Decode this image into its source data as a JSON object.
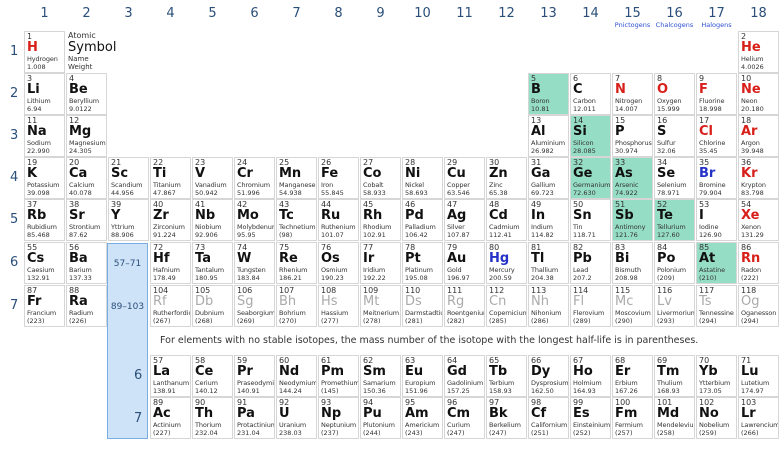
{
  "groups": [
    "1",
    "2",
    "3",
    "4",
    "5",
    "6",
    "7",
    "8",
    "9",
    "10",
    "11",
    "12",
    "13",
    "14",
    "15",
    "16",
    "17",
    "18"
  ],
  "group_subtitles": {
    "15": "Pnictogens",
    "16": "Chalcogens",
    "17": "Halogens"
  },
  "periods": [
    "1",
    "2",
    "3",
    "4",
    "5",
    "6",
    "7"
  ],
  "legend": {
    "z": "Atomic",
    "symbol": "Symbol",
    "name": "Name",
    "weight": "Weight"
  },
  "f_ranges": [
    "57–71",
    "89–103"
  ],
  "f_periods": [
    "6",
    "7"
  ],
  "note": "For elements with no stable isotopes, the mass number of the isotope with the longest half-life is in parentheses.",
  "elements": [
    {
      "z": "1",
      "s": "H",
      "n": "Hydrogen",
      "w": "1.008",
      "g": 1,
      "p": 1,
      "st": "gas"
    },
    {
      "z": "2",
      "s": "He",
      "n": "Helium",
      "w": "4.0026",
      "g": 18,
      "p": 1,
      "st": "gas"
    },
    {
      "z": "3",
      "s": "Li",
      "n": "Lithium",
      "w": "6.94",
      "g": 1,
      "p": 2
    },
    {
      "z": "4",
      "s": "Be",
      "n": "Beryllium",
      "w": "9.0122",
      "g": 2,
      "p": 2
    },
    {
      "z": "5",
      "s": "B",
      "n": "Boron",
      "w": "10.81",
      "g": 13,
      "p": 2,
      "m": 1
    },
    {
      "z": "6",
      "s": "C",
      "n": "Carbon",
      "w": "12.011",
      "g": 14,
      "p": 2
    },
    {
      "z": "7",
      "s": "N",
      "n": "Nitrogen",
      "w": "14.007",
      "g": 15,
      "p": 2,
      "st": "gas"
    },
    {
      "z": "8",
      "s": "O",
      "n": "Oxygen",
      "w": "15.999",
      "g": 16,
      "p": 2,
      "st": "gas"
    },
    {
      "z": "9",
      "s": "F",
      "n": "Fluorine",
      "w": "18.998",
      "g": 17,
      "p": 2,
      "st": "gas"
    },
    {
      "z": "10",
      "s": "Ne",
      "n": "Neon",
      "w": "20.180",
      "g": 18,
      "p": 2,
      "st": "gas"
    },
    {
      "z": "11",
      "s": "Na",
      "n": "Sodium",
      "w": "22.990",
      "g": 1,
      "p": 3
    },
    {
      "z": "12",
      "s": "Mg",
      "n": "Magnesium",
      "w": "24.305",
      "g": 2,
      "p": 3
    },
    {
      "z": "13",
      "s": "Al",
      "n": "Aluminium",
      "w": "26.982",
      "g": 13,
      "p": 3
    },
    {
      "z": "14",
      "s": "Si",
      "n": "Silicon",
      "w": "28.085",
      "g": 14,
      "p": 3,
      "m": 1
    },
    {
      "z": "15",
      "s": "P",
      "n": "Phosphorus",
      "w": "30.974",
      "g": 15,
      "p": 3
    },
    {
      "z": "16",
      "s": "S",
      "n": "Sulfur",
      "w": "32.06",
      "g": 16,
      "p": 3
    },
    {
      "z": "17",
      "s": "Cl",
      "n": "Chlorine",
      "w": "35.45",
      "g": 17,
      "p": 3,
      "st": "gas"
    },
    {
      "z": "18",
      "s": "Ar",
      "n": "Argon",
      "w": "39.948",
      "g": 18,
      "p": 3,
      "st": "gas"
    },
    {
      "z": "19",
      "s": "K",
      "n": "Potassium",
      "w": "39.098",
      "g": 1,
      "p": 4
    },
    {
      "z": "20",
      "s": "Ca",
      "n": "Calcium",
      "w": "40.078",
      "g": 2,
      "p": 4
    },
    {
      "z": "21",
      "s": "Sc",
      "n": "Scandium",
      "w": "44.956",
      "g": 3,
      "p": 4
    },
    {
      "z": "22",
      "s": "Ti",
      "n": "Titanium",
      "w": "47.867",
      "g": 4,
      "p": 4
    },
    {
      "z": "23",
      "s": "V",
      "n": "Vanadium",
      "w": "50.942",
      "g": 5,
      "p": 4
    },
    {
      "z": "24",
      "s": "Cr",
      "n": "Chromium",
      "w": "51.996",
      "g": 6,
      "p": 4
    },
    {
      "z": "25",
      "s": "Mn",
      "n": "Manganese",
      "w": "54.938",
      "g": 7,
      "p": 4
    },
    {
      "z": "26",
      "s": "Fe",
      "n": "Iron",
      "w": "55.845",
      "g": 8,
      "p": 4
    },
    {
      "z": "27",
      "s": "Co",
      "n": "Cobalt",
      "w": "58.933",
      "g": 9,
      "p": 4
    },
    {
      "z": "28",
      "s": "Ni",
      "n": "Nickel",
      "w": "58.693",
      "g": 10,
      "p": 4
    },
    {
      "z": "29",
      "s": "Cu",
      "n": "Copper",
      "w": "63.546",
      "g": 11,
      "p": 4
    },
    {
      "z": "30",
      "s": "Zn",
      "n": "Zinc",
      "w": "65.38",
      "g": 12,
      "p": 4
    },
    {
      "z": "31",
      "s": "Ga",
      "n": "Gallium",
      "w": "69.723",
      "g": 13,
      "p": 4
    },
    {
      "z": "32",
      "s": "Ge",
      "n": "Germanium",
      "w": "72.630",
      "g": 14,
      "p": 4,
      "m": 1
    },
    {
      "z": "33",
      "s": "As",
      "n": "Arsenic",
      "w": "74.922",
      "g": 15,
      "p": 4,
      "m": 1
    },
    {
      "z": "34",
      "s": "Se",
      "n": "Selenium",
      "w": "78.971",
      "g": 16,
      "p": 4
    },
    {
      "z": "35",
      "s": "Br",
      "n": "Bromine",
      "w": "79.904",
      "g": 17,
      "p": 4,
      "st": "liq"
    },
    {
      "z": "36",
      "s": "Kr",
      "n": "Krypton",
      "w": "83.798",
      "g": 18,
      "p": 4,
      "st": "gas"
    },
    {
      "z": "37",
      "s": "Rb",
      "n": "Rubidium",
      "w": "85.468",
      "g": 1,
      "p": 5
    },
    {
      "z": "38",
      "s": "Sr",
      "n": "Strontium",
      "w": "87.62",
      "g": 2,
      "p": 5
    },
    {
      "z": "39",
      "s": "Y",
      "n": "Yttrium",
      "w": "88.906",
      "g": 3,
      "p": 5
    },
    {
      "z": "40",
      "s": "Zr",
      "n": "Zirconium",
      "w": "91.224",
      "g": 4,
      "p": 5
    },
    {
      "z": "41",
      "s": "Nb",
      "n": "Niobium",
      "w": "92.906",
      "g": 5,
      "p": 5
    },
    {
      "z": "42",
      "s": "Mo",
      "n": "Molybdenum",
      "w": "95.95",
      "g": 6,
      "p": 5
    },
    {
      "z": "43",
      "s": "Tc",
      "n": "Technetium",
      "w": "(98)",
      "g": 7,
      "p": 5
    },
    {
      "z": "44",
      "s": "Ru",
      "n": "Ruthenium",
      "w": "101.07",
      "g": 8,
      "p": 5
    },
    {
      "z": "45",
      "s": "Rh",
      "n": "Rhodium",
      "w": "102.91",
      "g": 9,
      "p": 5
    },
    {
      "z": "46",
      "s": "Pd",
      "n": "Palladium",
      "w": "106.42",
      "g": 10,
      "p": 5
    },
    {
      "z": "47",
      "s": "Ag",
      "n": "Silver",
      "w": "107.87",
      "g": 11,
      "p": 5
    },
    {
      "z": "48",
      "s": "Cd",
      "n": "Cadmium",
      "w": "112.41",
      "g": 12,
      "p": 5
    },
    {
      "z": "49",
      "s": "In",
      "n": "Indium",
      "w": "114.82",
      "g": 13,
      "p": 5
    },
    {
      "z": "50",
      "s": "Sn",
      "n": "Tin",
      "w": "118.71",
      "g": 14,
      "p": 5
    },
    {
      "z": "51",
      "s": "Sb",
      "n": "Antimony",
      "w": "121.76",
      "g": 15,
      "p": 5,
      "m": 1
    },
    {
      "z": "52",
      "s": "Te",
      "n": "Tellurium",
      "w": "127.60",
      "g": 16,
      "p": 5,
      "m": 1
    },
    {
      "z": "53",
      "s": "I",
      "n": "Iodine",
      "w": "126.90",
      "g": 17,
      "p": 5
    },
    {
      "z": "54",
      "s": "Xe",
      "n": "Xenon",
      "w": "131.29",
      "g": 18,
      "p": 5,
      "st": "gas"
    },
    {
      "z": "55",
      "s": "Cs",
      "n": "Caesium",
      "w": "132.91",
      "g": 1,
      "p": 6
    },
    {
      "z": "56",
      "s": "Ba",
      "n": "Barium",
      "w": "137.33",
      "g": 2,
      "p": 6
    },
    {
      "z": "72",
      "s": "Hf",
      "n": "Hafnium",
      "w": "178.49",
      "g": 4,
      "p": 6
    },
    {
      "z": "73",
      "s": "Ta",
      "n": "Tantalum",
      "w": "180.95",
      "g": 5,
      "p": 6
    },
    {
      "z": "74",
      "s": "W",
      "n": "Tungsten",
      "w": "183.84",
      "g": 6,
      "p": 6
    },
    {
      "z": "75",
      "s": "Re",
      "n": "Rhenium",
      "w": "186.21",
      "g": 7,
      "p": 6
    },
    {
      "z": "76",
      "s": "Os",
      "n": "Osmium",
      "w": "190.23",
      "g": 8,
      "p": 6
    },
    {
      "z": "77",
      "s": "Ir",
      "n": "Iridium",
      "w": "192.22",
      "g": 9,
      "p": 6
    },
    {
      "z": "78",
      "s": "Pt",
      "n": "Platinum",
      "w": "195.08",
      "g": 10,
      "p": 6
    },
    {
      "z": "79",
      "s": "Au",
      "n": "Gold",
      "w": "196.97",
      "g": 11,
      "p": 6
    },
    {
      "z": "80",
      "s": "Hg",
      "n": "Mercury",
      "w": "200.59",
      "g": 12,
      "p": 6,
      "st": "liq"
    },
    {
      "z": "81",
      "s": "Tl",
      "n": "Thallium",
      "w": "204.38",
      "g": 13,
      "p": 6
    },
    {
      "z": "82",
      "s": "Pb",
      "n": "Lead",
      "w": "207.2",
      "g": 14,
      "p": 6
    },
    {
      "z": "83",
      "s": "Bi",
      "n": "Bismuth",
      "w": "208.98",
      "g": 15,
      "p": 6
    },
    {
      "z": "84",
      "s": "Po",
      "n": "Polonium",
      "w": "(209)",
      "g": 16,
      "p": 6
    },
    {
      "z": "85",
      "s": "At",
      "n": "Astatine",
      "w": "(210)",
      "g": 17,
      "p": 6,
      "m": 1
    },
    {
      "z": "86",
      "s": "Rn",
      "n": "Radon",
      "w": "(222)",
      "g": 18,
      "p": 6,
      "st": "gas"
    },
    {
      "z": "87",
      "s": "Fr",
      "n": "Francium",
      "w": "(223)",
      "g": 1,
      "p": 7
    },
    {
      "z": "88",
      "s": "Ra",
      "n": "Radium",
      "w": "(226)",
      "g": 2,
      "p": 7
    },
    {
      "z": "104",
      "s": "Rf",
      "n": "Rutherfordium",
      "w": "(267)",
      "g": 4,
      "p": 7,
      "st": "unk"
    },
    {
      "z": "105",
      "s": "Db",
      "n": "Dubnium",
      "w": "(268)",
      "g": 5,
      "p": 7,
      "st": "unk"
    },
    {
      "z": "106",
      "s": "Sg",
      "n": "Seaborgium",
      "w": "(269)",
      "g": 6,
      "p": 7,
      "st": "unk"
    },
    {
      "z": "107",
      "s": "Bh",
      "n": "Bohrium",
      "w": "(270)",
      "g": 7,
      "p": 7,
      "st": "unk"
    },
    {
      "z": "108",
      "s": "Hs",
      "n": "Hassium",
      "w": "(277)",
      "g": 8,
      "p": 7,
      "st": "unk"
    },
    {
      "z": "109",
      "s": "Mt",
      "n": "Meitnerium",
      "w": "(278)",
      "g": 9,
      "p": 7,
      "st": "unk"
    },
    {
      "z": "110",
      "s": "Ds",
      "n": "Darmstadtium",
      "w": "(281)",
      "g": 10,
      "p": 7,
      "st": "unk"
    },
    {
      "z": "111",
      "s": "Rg",
      "n": "Roentgenium",
      "w": "(282)",
      "g": 11,
      "p": 7,
      "st": "unk"
    },
    {
      "z": "112",
      "s": "Cn",
      "n": "Copernicium",
      "w": "(285)",
      "g": 12,
      "p": 7,
      "st": "unk"
    },
    {
      "z": "113",
      "s": "Nh",
      "n": "Nihonium",
      "w": "(286)",
      "g": 13,
      "p": 7,
      "st": "unk"
    },
    {
      "z": "114",
      "s": "Fl",
      "n": "Flerovium",
      "w": "(289)",
      "g": 14,
      "p": 7,
      "st": "unk"
    },
    {
      "z": "115",
      "s": "Mc",
      "n": "Moscovium",
      "w": "(290)",
      "g": 15,
      "p": 7,
      "st": "unk"
    },
    {
      "z": "116",
      "s": "Lv",
      "n": "Livermorium",
      "w": "(293)",
      "g": 16,
      "p": 7,
      "st": "unk"
    },
    {
      "z": "117",
      "s": "Ts",
      "n": "Tennessine",
      "w": "(294)",
      "g": 17,
      "p": 7,
      "st": "unk"
    },
    {
      "z": "118",
      "s": "Og",
      "n": "Oganesson",
      "w": "(294)",
      "g": 18,
      "p": 7,
      "st": "unk"
    },
    {
      "z": "57",
      "s": "La",
      "n": "Lanthanum",
      "w": "138.91",
      "g": 4,
      "p": "f6"
    },
    {
      "z": "58",
      "s": "Ce",
      "n": "Cerium",
      "w": "140.12",
      "g": 5,
      "p": "f6"
    },
    {
      "z": "59",
      "s": "Pr",
      "n": "Praseodymium",
      "w": "140.91",
      "g": 6,
      "p": "f6"
    },
    {
      "z": "60",
      "s": "Nd",
      "n": "Neodymium",
      "w": "144.24",
      "g": 7,
      "p": "f6"
    },
    {
      "z": "61",
      "s": "Pm",
      "n": "Promethium",
      "w": "(145)",
      "g": 8,
      "p": "f6"
    },
    {
      "z": "62",
      "s": "Sm",
      "n": "Samarium",
      "w": "150.36",
      "g": 9,
      "p": "f6"
    },
    {
      "z": "63",
      "s": "Eu",
      "n": "Europium",
      "w": "151.96",
      "g": 10,
      "p": "f6"
    },
    {
      "z": "64",
      "s": "Gd",
      "n": "Gadolinium",
      "w": "157.25",
      "g": 11,
      "p": "f6"
    },
    {
      "z": "65",
      "s": "Tb",
      "n": "Terbium",
      "w": "158.93",
      "g": 12,
      "p": "f6"
    },
    {
      "z": "66",
      "s": "Dy",
      "n": "Dysprosium",
      "w": "162.50",
      "g": 13,
      "p": "f6"
    },
    {
      "z": "67",
      "s": "Ho",
      "n": "Holmium",
      "w": "164.93",
      "g": 14,
      "p": "f6"
    },
    {
      "z": "68",
      "s": "Er",
      "n": "Erbium",
      "w": "167.26",
      "g": 15,
      "p": "f6"
    },
    {
      "z": "69",
      "s": "Tm",
      "n": "Thulium",
      "w": "168.93",
      "g": 16,
      "p": "f6"
    },
    {
      "z": "70",
      "s": "Yb",
      "n": "Ytterbium",
      "w": "173.05",
      "g": 17,
      "p": "f6"
    },
    {
      "z": "71",
      "s": "Lu",
      "n": "Lutetium",
      "w": "174.97",
      "g": 18,
      "p": "f6"
    },
    {
      "z": "89",
      "s": "Ac",
      "n": "Actinium",
      "w": "(227)",
      "g": 4,
      "p": "f7"
    },
    {
      "z": "90",
      "s": "Th",
      "n": "Thorium",
      "w": "232.04",
      "g": 5,
      "p": "f7"
    },
    {
      "z": "91",
      "s": "Pa",
      "n": "Protactinium",
      "w": "231.04",
      "g": 6,
      "p": "f7"
    },
    {
      "z": "92",
      "s": "U",
      "n": "Uranium",
      "w": "238.03",
      "g": 7,
      "p": "f7"
    },
    {
      "z": "93",
      "s": "Np",
      "n": "Neptunium",
      "w": "(237)",
      "g": 8,
      "p": "f7"
    },
    {
      "z": "94",
      "s": "Pu",
      "n": "Plutonium",
      "w": "(244)",
      "g": 9,
      "p": "f7"
    },
    {
      "z": "95",
      "s": "Am",
      "n": "Americium",
      "w": "(243)",
      "g": 10,
      "p": "f7"
    },
    {
      "z": "96",
      "s": "Cm",
      "n": "Curium",
      "w": "(247)",
      "g": 11,
      "p": "f7"
    },
    {
      "z": "97",
      "s": "Bk",
      "n": "Berkelium",
      "w": "(247)",
      "g": 12,
      "p": "f7"
    },
    {
      "z": "98",
      "s": "Cf",
      "n": "Californium",
      "w": "(251)",
      "g": 13,
      "p": "f7"
    },
    {
      "z": "99",
      "s": "Es",
      "n": "Einsteinium",
      "w": "(252)",
      "g": 14,
      "p": "f7"
    },
    {
      "z": "100",
      "s": "Fm",
      "n": "Fermium",
      "w": "(257)",
      "g": 15,
      "p": "f7"
    },
    {
      "z": "101",
      "s": "Md",
      "n": "Mendelevium",
      "w": "(258)",
      "g": 16,
      "p": "f7"
    },
    {
      "z": "102",
      "s": "No",
      "n": "Nobelium",
      "w": "(259)",
      "g": 17,
      "p": "f7"
    },
    {
      "z": "103",
      "s": "Lr",
      "n": "Lawrencium",
      "w": "(266)",
      "g": 18,
      "p": "f7"
    }
  ],
  "colors": {
    "metalloid": "#96ddc6",
    "gas": "#d8201b",
    "liquid": "#2532c8",
    "unknown": "#aaaaaa",
    "fblock": "#cfe3f8"
  }
}
